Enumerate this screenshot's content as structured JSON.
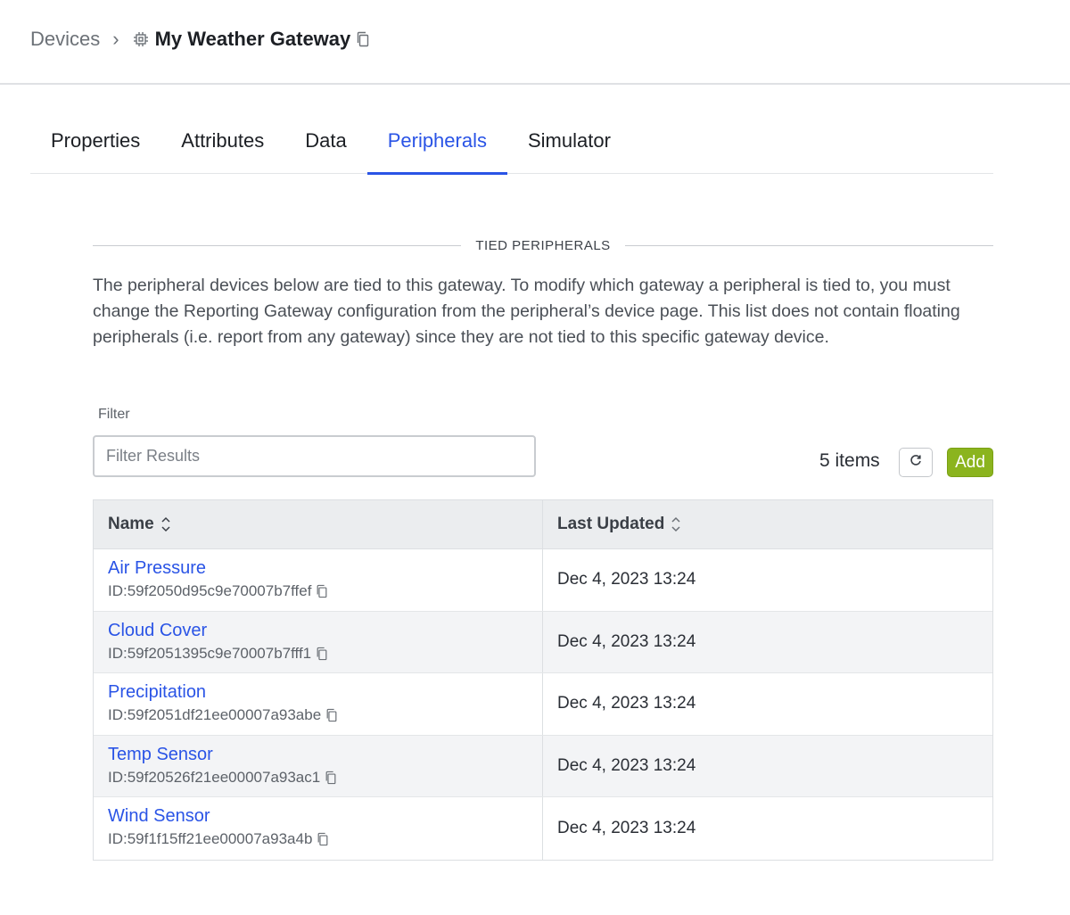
{
  "breadcrumb": {
    "parent": "Devices",
    "separator": "›",
    "current": "My Weather Gateway"
  },
  "tabs": [
    {
      "label": "Properties",
      "active": false
    },
    {
      "label": "Attributes",
      "active": false
    },
    {
      "label": "Data",
      "active": false
    },
    {
      "label": "Peripherals",
      "active": true
    },
    {
      "label": "Simulator",
      "active": false
    }
  ],
  "section": {
    "title": "TIED PERIPHERALS",
    "description": "The peripheral devices below are tied to this gateway. To modify which gateway a peripheral is tied to, you must change the Reporting Gateway configuration from the peripheral’s device page. This list does not contain floating peripherals (i.e. report from any gateway) since they are not tied to this specific gateway device."
  },
  "filter": {
    "label": "Filter",
    "placeholder": "Filter Results",
    "value": ""
  },
  "toolbar": {
    "items_count": "5 items",
    "add_label": "Add"
  },
  "table": {
    "columns": [
      "Name",
      "Last Updated"
    ],
    "rows": [
      {
        "name": "Air Pressure",
        "id": "ID:59f2050d95c9e70007b7ffef",
        "updated": "Dec 4, 2023 13:24"
      },
      {
        "name": "Cloud Cover",
        "id": "ID:59f2051395c9e70007b7fff1",
        "updated": "Dec 4, 2023 13:24"
      },
      {
        "name": "Precipitation",
        "id": "ID:59f2051df21ee00007a93abe",
        "updated": "Dec 4, 2023 13:24"
      },
      {
        "name": "Temp Sensor",
        "id": "ID:59f20526f21ee00007a93ac1",
        "updated": "Dec 4, 2023 13:24"
      },
      {
        "name": "Wind Sensor",
        "id": "ID:59f1f15ff21ee00007a93a4b",
        "updated": "Dec 4, 2023 13:24"
      }
    ]
  },
  "colors": {
    "accent": "#2a54e6",
    "add_button": "#8bb41e"
  },
  "icons": {
    "device": "chip-icon",
    "copy": "copy-icon",
    "refresh": "refresh-icon",
    "sort": "sort-icon"
  }
}
